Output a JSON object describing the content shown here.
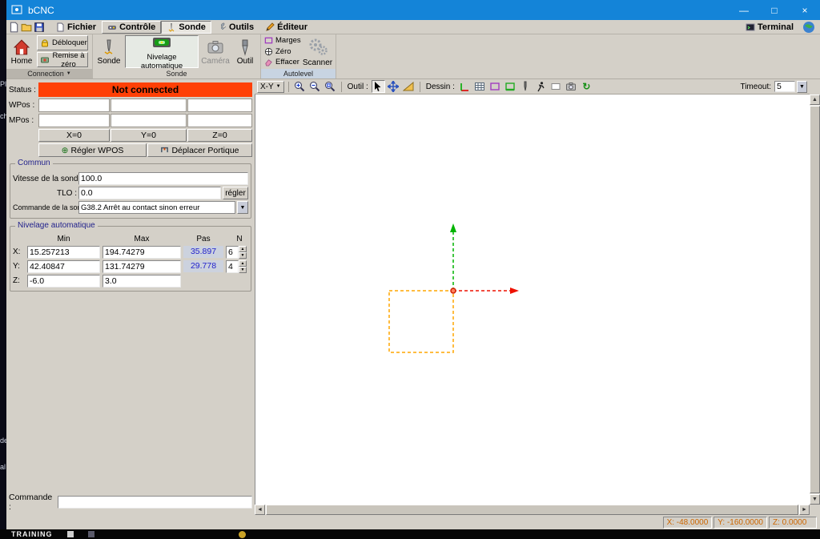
{
  "desktop": {
    "fragments": [
      "Pla",
      "ch",
      "de",
      "al"
    ]
  },
  "window": {
    "title": "bCNC",
    "minimize": "—",
    "maximize": "□",
    "close": "×"
  },
  "glyphs": {
    "up": "▲",
    "down": "▼",
    "left": "◄",
    "right": "►",
    "crosshair": "⊕",
    "refresh": "↻"
  },
  "menubar": {
    "tab_file": "Fichier",
    "tab_control": "Contrôle",
    "tab_probe": "Sonde",
    "tab_tools": "Outils",
    "tab_editor": "Éditeur",
    "terminal": "Terminal"
  },
  "ribbon": {
    "home": "Home",
    "unlock": "Débloquer",
    "reset": "Remise à zéro",
    "group_connection": "Connection",
    "probe": "Sonde",
    "autolevel": "Nivelage automatique",
    "camera": "Caméra",
    "tool": "Outil",
    "group_probe": "Sonde",
    "margins": "Marges",
    "zero": "Zéro",
    "clear": "Effacer",
    "scanner": "Scanner",
    "group_autolevel": "Autolevel"
  },
  "panel": {
    "status_label": "Status :",
    "status_value": "Not connected",
    "wpos_label": "WPos :",
    "mpos_label": "MPos :",
    "btn_x0": "X=0",
    "btn_y0": "Y=0",
    "btn_z0": "Z=0",
    "btn_set_wpos": "Régler WPOS",
    "btn_move_gantry": "Déplacer Portique",
    "common_title": "Commun",
    "feed_label": "Vitesse de la sonde :",
    "feed_value": "100.0",
    "tlo_label": "TLO :",
    "tlo_value": "0.0",
    "btn_set": "régler",
    "probe_cmd_label": "Commande de la sonde :",
    "probe_cmd_value": "G38.2 Arrêt au contact sinon erreur",
    "autolevel_title": "Nivelage automatique",
    "col_min": "Min",
    "col_max": "Max",
    "col_step": "Pas",
    "col_n": "N",
    "rows": [
      {
        "axis": "X:",
        "min": "15.257213",
        "max": "194.74279",
        "step": "35.897",
        "n": "6"
      },
      {
        "axis": "Y:",
        "min": "42.40847",
        "max": "131.74279",
        "step": "29.778",
        "n": "4"
      },
      {
        "axis": "Z:",
        "min": "-6.0",
        "max": "3.0",
        "step": "",
        "n": ""
      }
    ],
    "command_label": "Commande :",
    "command_value": ""
  },
  "canvas_toolbar": {
    "view": "X-Y",
    "tool_label": "Outil :",
    "draw_label": "Dessin :",
    "timeout_label": "Timeout:",
    "timeout_value": "5"
  },
  "statusbar": {
    "x": "X: -48.0000",
    "y": "Y: -160.0000",
    "z": "Z: 0.0000"
  },
  "taskbar": {
    "label": "TRAINING"
  },
  "colors": {
    "titlebar": "#1484d8",
    "status_error": "#ff4006",
    "group_title": "#22228c",
    "step_text": "#2222cc",
    "coord_text": "#cc6600",
    "axis_green": "#00b400",
    "axis_red": "#ee1100",
    "margin_orange": "#ffa500"
  }
}
